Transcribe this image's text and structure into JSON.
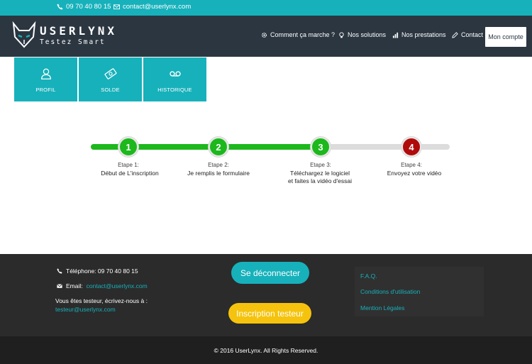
{
  "topbar": {
    "phone": "09 70 40 80 15",
    "email": "contact@userlynx.com"
  },
  "brand": {
    "name": "USERLYNX",
    "tagline": "Testez Smart"
  },
  "nav": {
    "items": [
      {
        "label": "Comment ça marche ?",
        "icon": "gear-icon"
      },
      {
        "label": "Nos solutions",
        "icon": "lightbulb-icon"
      },
      {
        "label": "Nos prestations",
        "icon": "bar-chart-icon"
      },
      {
        "label": "Contact",
        "icon": "pencil-icon"
      }
    ],
    "account": "Mon compte"
  },
  "tiles": [
    {
      "label": "PROFIL",
      "icon": "user-icon"
    },
    {
      "label": "SOLDE",
      "icon": "money-icon"
    },
    {
      "label": "HISTORIQUE",
      "icon": "voicemail-icon"
    }
  ],
  "steps": [
    {
      "number": "1",
      "title": "Etape 1:",
      "desc": "Début de L'inscription",
      "status": "done"
    },
    {
      "number": "2",
      "title": "Etape 2:",
      "desc": "Je remplis le formulaire",
      "status": "done"
    },
    {
      "number": "3",
      "title": "Etape 3:",
      "desc": "Téléchargez le logiciel\net faites la vidéo d'essai",
      "status": "done"
    },
    {
      "number": "4",
      "title": "Etape 4:",
      "desc": "Envoyez votre vidéo",
      "status": "pending"
    }
  ],
  "colors": {
    "accent": "#17b1bb",
    "done": "#1cb81c",
    "pending": "#b00b0b",
    "signup": "#f5c30d"
  },
  "footer": {
    "phone_label": "Téléphone: 09 70 40 80 15",
    "email_label": "Email:",
    "email_value": "contact@userlynx.com",
    "tester_label": "Vous êtes testeur, écrivez-nous à :",
    "tester_email": "testeur@userlynx.com",
    "logout": "Se déconnecter",
    "signup": "Inscription testeur",
    "links": [
      "F.A.Q.",
      "Conditions d'utilisation",
      "Mention Légales"
    ],
    "copyright": "© 2016 UserLynx. All Rights Reserved."
  }
}
